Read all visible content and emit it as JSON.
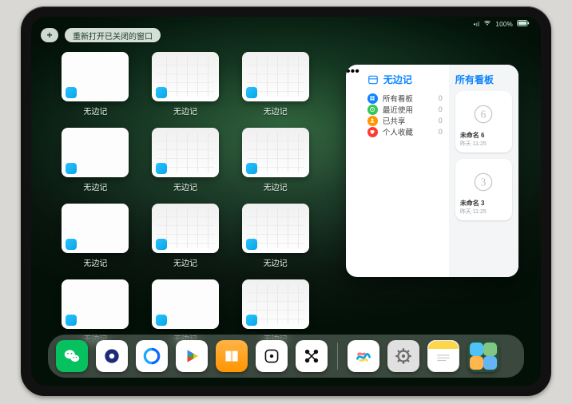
{
  "status": {
    "signal": "•ıl",
    "wifi": "wifi",
    "battery_text": "100%",
    "battery_icon": "batt"
  },
  "topbar": {
    "plus": "+",
    "reopen_label": "重新打开已关闭的窗口"
  },
  "app_switcher": {
    "app_label": "无边记",
    "tiles": [
      {
        "variant": "blank"
      },
      {
        "variant": "cal"
      },
      {
        "variant": "cal"
      },
      {
        "variant": "blank"
      },
      {
        "variant": "cal"
      },
      {
        "variant": "cal"
      },
      {
        "variant": "blank"
      },
      {
        "variant": "cal"
      },
      {
        "variant": "cal"
      },
      {
        "variant": "blank"
      },
      {
        "variant": "blank"
      },
      {
        "variant": "cal"
      }
    ]
  },
  "panel": {
    "left_title": "无边记",
    "items": [
      {
        "icon_color": "#0a84ff",
        "label": "所有看板",
        "count": "0",
        "glyph": "grid"
      },
      {
        "icon_color": "#34c759",
        "label": "最近使用",
        "count": "0",
        "glyph": "clock"
      },
      {
        "icon_color": "#ff9500",
        "label": "已共享",
        "count": "0",
        "glyph": "person"
      },
      {
        "icon_color": "#ff3b30",
        "label": "个人收藏",
        "count": "0",
        "glyph": "heart"
      }
    ],
    "right_title": "所有看板",
    "boards": [
      {
        "name": "未命名 6",
        "subtitle": "昨天 11:25",
        "digit": "6"
      },
      {
        "name": "未命名 3",
        "subtitle": "昨天 11:25",
        "digit": "3"
      }
    ],
    "ellipsis": "•••"
  },
  "dock": {
    "left": [
      {
        "name": "wechat",
        "title": "WeChat"
      },
      {
        "name": "quark",
        "title": "Quark"
      },
      {
        "name": "qqbrowser",
        "title": "QQ Browser"
      },
      {
        "name": "play",
        "title": "Play"
      },
      {
        "name": "books",
        "title": "Books"
      },
      {
        "name": "dice",
        "title": "Game"
      },
      {
        "name": "nodes",
        "title": "Nodes"
      }
    ],
    "right": [
      {
        "name": "freeform",
        "title": "无边记"
      },
      {
        "name": "settings",
        "title": "Settings"
      },
      {
        "name": "notes",
        "title": "Notes"
      },
      {
        "name": "app-library",
        "title": "App Library"
      }
    ]
  }
}
